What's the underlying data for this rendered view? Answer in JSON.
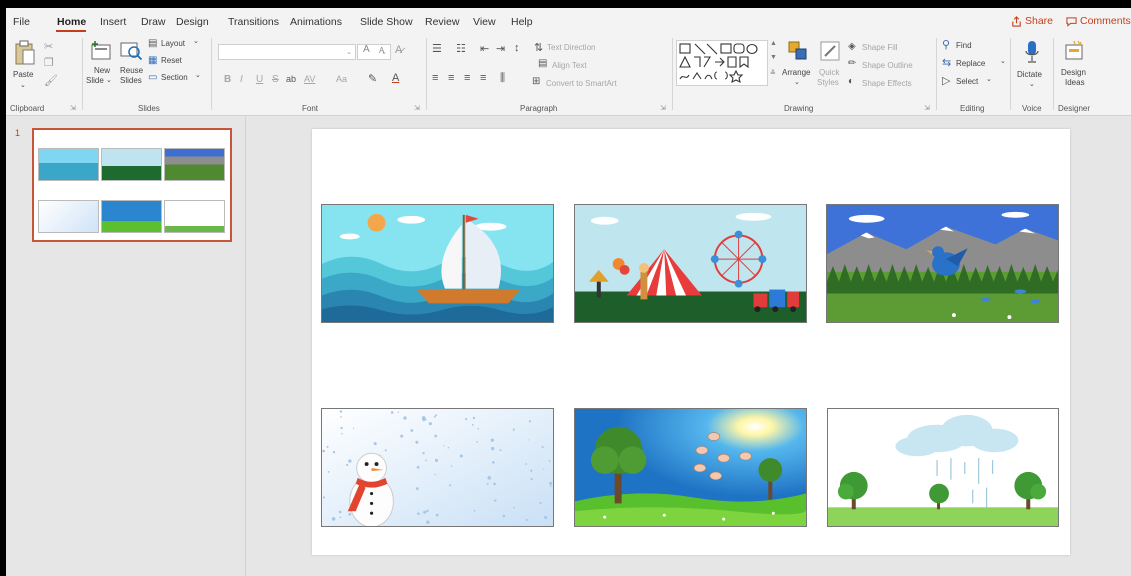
{
  "menu": {
    "tabs": [
      "File",
      "Home",
      "Insert",
      "Draw",
      "Design",
      "Transitions",
      "Animations",
      "Slide Show",
      "Review",
      "View",
      "Help"
    ],
    "active_tab": "Home",
    "share_label": "Share",
    "comments_label": "Comments"
  },
  "ribbon": {
    "clipboard": {
      "paste": "Paste",
      "group": "Clipboard"
    },
    "slides": {
      "new_slide_1": "New",
      "new_slide_2": "Slide",
      "reuse_1": "Reuse",
      "reuse_2": "Slides",
      "layout": "Layout",
      "reset": "Reset",
      "section": "Section",
      "group": "Slides"
    },
    "font": {
      "bold": "B",
      "italic": "I",
      "underline": "U",
      "strike": "S",
      "spacing": "AV",
      "case": "Aa",
      "grow": "A",
      "shrink": "A",
      "group": "Font"
    },
    "paragraph": {
      "text_direction": "Text Direction",
      "align_text": "Align Text",
      "convert_smartart": "Convert to SmartArt",
      "group": "Paragraph"
    },
    "drawing": {
      "arrange": "Arrange",
      "quick_styles_1": "Quick",
      "quick_styles_2": "Styles",
      "shape_fill": "Shape Fill",
      "shape_outline": "Shape Outline",
      "shape_effects": "Shape Effects",
      "group": "Drawing"
    },
    "editing": {
      "find": "Find",
      "replace": "Replace",
      "select": "Select",
      "group": "Editing"
    },
    "voice": {
      "dictate": "Dictate",
      "group": "Voice"
    },
    "designer": {
      "design_ideas_1": "Design",
      "design_ideas_2": "Ideas",
      "group": "Designer"
    }
  },
  "thumbnails": {
    "slide_number": "1"
  },
  "colors": {
    "accent": "#c43e1c",
    "ribbon_bg": "#f3f3f3",
    "canvas_bg": "#e6e6e6"
  }
}
